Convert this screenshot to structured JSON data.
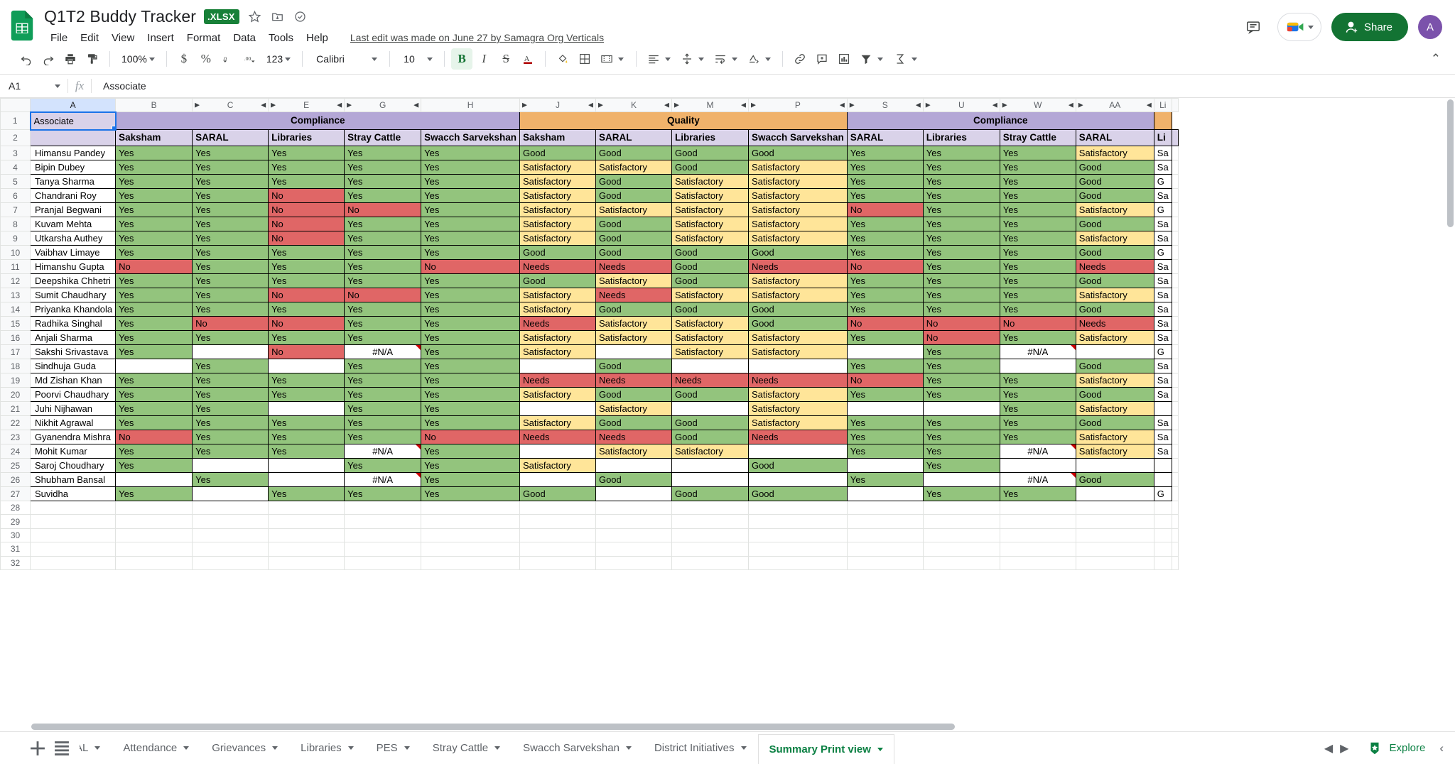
{
  "titlebar": {
    "doc_title": "Q1T2 Buddy Tracker",
    "file_badge": ".XLSX",
    "icons": [
      "star-icon",
      "move-to-folder-icon",
      "cloud-saved-icon"
    ],
    "menus": [
      "File",
      "Edit",
      "View",
      "Insert",
      "Format",
      "Data",
      "Tools",
      "Help"
    ],
    "last_edit": "Last edit was made on June 27 by Samagra Org Verticals",
    "share_label": "Share",
    "avatar_initial": "A"
  },
  "toolbar": {
    "zoom": "100%",
    "font": "Calibri",
    "font_size": "10",
    "number_format": "123",
    "bold": "B",
    "italic": "I",
    "strike": "S"
  },
  "formula_bar": {
    "name_box": "A1",
    "fx": "fx",
    "value": "Associate"
  },
  "grid": {
    "columns": [
      "A",
      "B",
      "C",
      "E",
      "G",
      "H",
      "J",
      "K",
      "M",
      "P",
      "S",
      "U",
      "W",
      "AA",
      "Li"
    ],
    "selected_column": "A",
    "row_numbers": [
      1,
      2,
      3,
      4,
      5,
      6,
      7,
      8,
      9,
      10,
      11,
      12,
      13,
      14,
      15,
      16,
      17,
      18,
      19,
      20,
      21,
      22,
      23,
      24,
      25,
      26,
      27,
      28,
      29,
      30,
      31,
      32
    ],
    "group_headers": [
      {
        "label": "Compliance",
        "color": "#b4a7d6",
        "span": 5
      },
      {
        "label": "Quality",
        "color": "#f0b26b",
        "span": 4
      },
      {
        "label": "Compliance",
        "color": "#b4a7d6",
        "span": 4
      }
    ],
    "a1_value": "Associate",
    "sub_headers": [
      "",
      "Saksham",
      "SARAL",
      "Libraries",
      "Stray Cattle",
      "Swacch Sarvekshan",
      "Saksham",
      "SARAL",
      "Libraries",
      "Swacch Sarvekshan",
      "SARAL",
      "Libraries",
      "Stray Cattle",
      "SARAL",
      "Li"
    ],
    "rows": [
      {
        "row": 3,
        "name": "Himansu Pandey",
        "cells": [
          "Yes",
          "Yes",
          "Yes",
          "Yes",
          "Yes",
          "Good",
          "Good",
          "Good",
          "Good",
          "Yes",
          "Yes",
          "Yes",
          "Satisfactory",
          "Sa"
        ]
      },
      {
        "row": 4,
        "name": "Bipin Dubey",
        "cells": [
          "Yes",
          "Yes",
          "Yes",
          "Yes",
          "Yes",
          "Satisfactory",
          "Satisfactory",
          "Good",
          "Satisfactory",
          "Yes",
          "Yes",
          "Yes",
          "Good",
          "Sa"
        ]
      },
      {
        "row": 5,
        "name": "Tanya Sharma",
        "cells": [
          "Yes",
          "Yes",
          "Yes",
          "Yes",
          "Yes",
          "Satisfactory",
          "Good",
          "Satisfactory",
          "Satisfactory",
          "Yes",
          "Yes",
          "Yes",
          "Good",
          "G"
        ]
      },
      {
        "row": 6,
        "name": "Chandrani Roy",
        "cells": [
          "Yes",
          "Yes",
          "No",
          "Yes",
          "Yes",
          "Satisfactory",
          "Good",
          "Satisfactory",
          "Satisfactory",
          "Yes",
          "Yes",
          "Yes",
          "Good",
          "Sa"
        ]
      },
      {
        "row": 7,
        "name": "Pranjal Begwani",
        "cells": [
          "Yes",
          "Yes",
          "No",
          "No",
          "Yes",
          "Satisfactory",
          "Satisfactory",
          "Satisfactory",
          "Satisfactory",
          "No",
          "Yes",
          "Yes",
          "Satisfactory",
          "G"
        ]
      },
      {
        "row": 8,
        "name": "Kuvam Mehta",
        "cells": [
          "Yes",
          "Yes",
          "No",
          "Yes",
          "Yes",
          "Satisfactory",
          "Good",
          "Satisfactory",
          "Satisfactory",
          "Yes",
          "Yes",
          "Yes",
          "Good",
          "Sa"
        ]
      },
      {
        "row": 9,
        "name": "Utkarsha Authey",
        "cells": [
          "Yes",
          "Yes",
          "No",
          "Yes",
          "Yes",
          "Satisfactory",
          "Good",
          "Satisfactory",
          "Satisfactory",
          "Yes",
          "Yes",
          "Yes",
          "Satisfactory",
          "Sa"
        ]
      },
      {
        "row": 10,
        "name": "Vaibhav Limaye",
        "cells": [
          "Yes",
          "Yes",
          "Yes",
          "Yes",
          "Yes",
          "Good",
          "Good",
          "Good",
          "Good",
          "Yes",
          "Yes",
          "Yes",
          "Good",
          "G"
        ]
      },
      {
        "row": 11,
        "name": "Himanshu Gupta",
        "cells": [
          "No",
          "Yes",
          "Yes",
          "Yes",
          "No",
          "Needs",
          "Needs",
          "Good",
          "Needs",
          "No",
          "Yes",
          "Yes",
          "Needs",
          "Sa"
        ]
      },
      {
        "row": 12,
        "name": "Deepshika Chhetri",
        "cells": [
          "Yes",
          "Yes",
          "Yes",
          "Yes",
          "Yes",
          "Good",
          "Satisfactory",
          "Good",
          "Satisfactory",
          "Yes",
          "Yes",
          "Yes",
          "Good",
          "Sa"
        ]
      },
      {
        "row": 13,
        "name": "Sumit Chaudhary",
        "cells": [
          "Yes",
          "Yes",
          "No",
          "No",
          "Yes",
          "Satisfactory",
          "Needs",
          "Satisfactory",
          "Satisfactory",
          "Yes",
          "Yes",
          "Yes",
          "Satisfactory",
          "Sa"
        ]
      },
      {
        "row": 14,
        "name": "Priyanka Khandola",
        "cells": [
          "Yes",
          "Yes",
          "Yes",
          "Yes",
          "Yes",
          "Satisfactory",
          "Good",
          "Good",
          "Good",
          "Yes",
          "Yes",
          "Yes",
          "Good",
          "Sa"
        ]
      },
      {
        "row": 15,
        "name": "Radhika Singhal",
        "cells": [
          "Yes",
          "No",
          "No",
          "Yes",
          "Yes",
          "Needs",
          "Satisfactory",
          "Satisfactory",
          "Good",
          "No",
          "No",
          "No",
          "Needs",
          "Sa"
        ]
      },
      {
        "row": 16,
        "name": "Anjali Sharma",
        "cells": [
          "Yes",
          "Yes",
          "Yes",
          "Yes",
          "Yes",
          "Satisfactory",
          "Satisfactory",
          "Satisfactory",
          "Satisfactory",
          "Yes",
          "No",
          "Yes",
          "Satisfactory",
          "Sa"
        ]
      },
      {
        "row": 17,
        "name": "Sakshi Srivastava",
        "cells": [
          "Yes",
          "",
          "No",
          "#N/A",
          "Yes",
          "Satisfactory",
          "",
          "Satisfactory",
          "Satisfactory",
          "",
          "Yes",
          "#N/A",
          "",
          "G"
        ]
      },
      {
        "row": 18,
        "name": "Sindhuja Guda",
        "cells": [
          "",
          "Yes",
          "",
          "Yes",
          "Yes",
          "",
          "Good",
          "",
          "",
          "Yes",
          "Yes",
          "",
          "Good",
          "Sa"
        ]
      },
      {
        "row": 19,
        "name": "Md Zishan Khan",
        "cells": [
          "Yes",
          "Yes",
          "Yes",
          "Yes",
          "Yes",
          "Needs",
          "Needs",
          "Needs",
          "Needs",
          "No",
          "Yes",
          "Yes",
          "Satisfactory",
          "Sa"
        ]
      },
      {
        "row": 20,
        "name": "Poorvi Chaudhary",
        "cells": [
          "Yes",
          "Yes",
          "Yes",
          "Yes",
          "Yes",
          "Satisfactory",
          "Good",
          "Good",
          "Satisfactory",
          "Yes",
          "Yes",
          "Yes",
          "Good",
          "Sa"
        ]
      },
      {
        "row": 21,
        "name": "Juhi Nijhawan",
        "cells": [
          "Yes",
          "Yes",
          "",
          "Yes",
          "Yes",
          "",
          "Satisfactory",
          "",
          "Satisfactory",
          "",
          "",
          "Yes",
          "Satisfactory",
          ""
        ]
      },
      {
        "row": 22,
        "name": "Nikhit Agrawal",
        "cells": [
          "Yes",
          "Yes",
          "Yes",
          "Yes",
          "Yes",
          "Satisfactory",
          "Good",
          "Good",
          "Satisfactory",
          "Yes",
          "Yes",
          "Yes",
          "Good",
          "Sa"
        ]
      },
      {
        "row": 23,
        "name": "Gyanendra Mishra",
        "cells": [
          "No",
          "Yes",
          "Yes",
          "Yes",
          "No",
          "Needs",
          "Needs",
          "Good",
          "Needs",
          "Yes",
          "Yes",
          "Yes",
          "Satisfactory",
          "Sa"
        ]
      },
      {
        "row": 24,
        "name": "Mohit Kumar",
        "cells": [
          "Yes",
          "Yes",
          "Yes",
          "#N/A",
          "Yes",
          "",
          "Satisfactory",
          "Satisfactory",
          "",
          "Yes",
          "Yes",
          "#N/A",
          "Satisfactory",
          "Sa"
        ]
      },
      {
        "row": 25,
        "name": "Saroj Choudhary",
        "cells": [
          "Yes",
          "",
          "",
          "Yes",
          "Yes",
          "Satisfactory",
          "",
          "",
          "Good",
          "",
          "Yes",
          "",
          "",
          ""
        ]
      },
      {
        "row": 26,
        "name": "Shubham Bansal",
        "cells": [
          "",
          "Yes",
          "",
          "#N/A",
          "Yes",
          "",
          "Good",
          "",
          "",
          "Yes",
          "",
          "#N/A",
          "Good",
          ""
        ]
      },
      {
        "row": 27,
        "name": "Suvidha",
        "cells": [
          "Yes",
          "",
          "Yes",
          "Yes",
          "Yes",
          "Good",
          "",
          "Good",
          "Good",
          "",
          "Yes",
          "Yes",
          "",
          "G"
        ]
      }
    ],
    "blank_rows": [
      28,
      29,
      30,
      31,
      32
    ],
    "colors": {
      "green": "#93c47d",
      "red": "#e06666",
      "yellow": "#ffe599",
      "compliance_header": "#b4a7d6",
      "quality_header": "#f0b26b",
      "subheader": "#d9d2e9"
    }
  },
  "sheet_tabs": {
    "add_label": "+",
    "all_sheets_label": "all-sheets-icon",
    "tabs": [
      {
        "label": "AL",
        "active": false
      },
      {
        "label": "Attendance",
        "active": false
      },
      {
        "label": "Grievances",
        "active": false
      },
      {
        "label": "Libraries",
        "active": false
      },
      {
        "label": "PES",
        "active": false
      },
      {
        "label": "Stray Cattle",
        "active": false
      },
      {
        "label": "Swacch Sarvekshan",
        "active": false
      },
      {
        "label": "District Initiatives",
        "active": false
      },
      {
        "label": "Summary Print view",
        "active": true
      }
    ],
    "explore_label": "Explore"
  }
}
